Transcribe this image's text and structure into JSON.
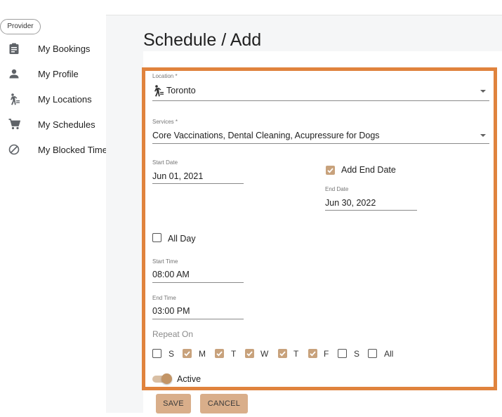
{
  "sidebar": {
    "chip": "Provider",
    "items": [
      {
        "label": "My Bookings",
        "icon": "clipboard-icon"
      },
      {
        "label": "My Profile",
        "icon": "person-icon"
      },
      {
        "label": "My Locations",
        "icon": "walking-person-icon"
      },
      {
        "label": "My Schedules",
        "icon": "cart-icon"
      },
      {
        "label": "My Blocked Times",
        "icon": "blocked-icon"
      }
    ]
  },
  "page": {
    "title": "Schedule / Add"
  },
  "form": {
    "location": {
      "label": "Location *",
      "value": "Toronto",
      "icon": "walking-person-icon"
    },
    "services": {
      "label": "Services *",
      "value": "Core Vaccinations, Dental Cleaning, Acupressure for Dogs"
    },
    "start_date": {
      "label": "Start Date",
      "value": "Jun 01, 2021"
    },
    "add_end_date": {
      "label": "Add End Date",
      "checked": true
    },
    "end_date": {
      "label": "End Date",
      "value": "Jun 30, 2022"
    },
    "all_day": {
      "label": "All Day",
      "checked": false
    },
    "start_time": {
      "label": "Start Time",
      "value": "08:00 AM"
    },
    "end_time": {
      "label": "End Time",
      "value": "03:00 PM"
    },
    "repeat_on": {
      "label": "Repeat On",
      "days": [
        {
          "label": "S",
          "checked": false
        },
        {
          "label": "M",
          "checked": true
        },
        {
          "label": "T",
          "checked": true
        },
        {
          "label": "W",
          "checked": true
        },
        {
          "label": "T",
          "checked": true
        },
        {
          "label": "F",
          "checked": true
        },
        {
          "label": "S",
          "checked": false
        },
        {
          "label": "All",
          "checked": false
        }
      ]
    },
    "active": {
      "label": "Active",
      "on": true
    }
  },
  "buttons": {
    "save": "SAVE",
    "cancel": "CANCEL"
  },
  "colors": {
    "accent": "#c8a27c",
    "button": "#d9ae8a",
    "highlight_frame": "#e0833d"
  }
}
